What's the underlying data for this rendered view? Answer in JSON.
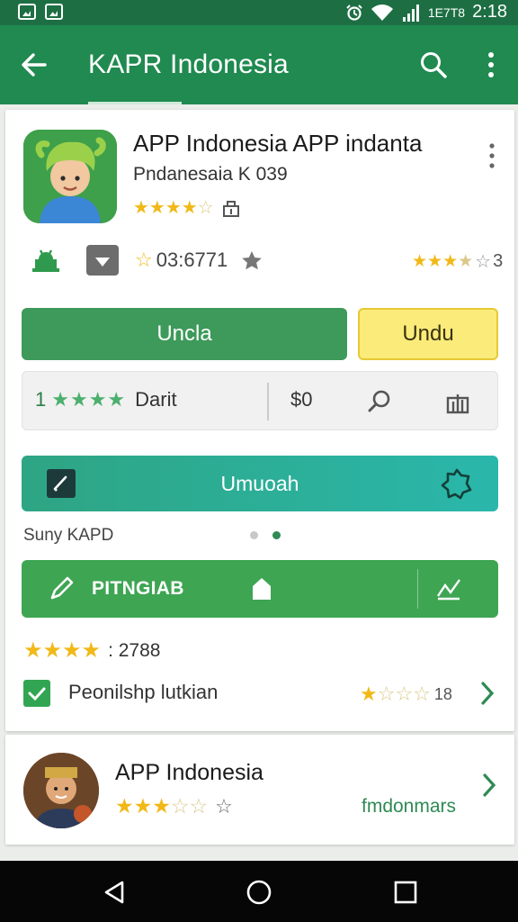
{
  "status_bar": {
    "carrier": "1E7T8",
    "time": "2:18"
  },
  "app_bar": {
    "title": "KAPR Indonesia"
  },
  "app": {
    "title": "APP Indonesia APP indanta",
    "subtitle": "Pndanesaia K 039",
    "rating_stars": 4.5
  },
  "stats": {
    "downloads": "03:6771",
    "right_rating_suffix": "3"
  },
  "buttons": {
    "primary": "Uncla",
    "secondary": "Undu"
  },
  "info": {
    "rating_number": "1",
    "rating_label": "Darit",
    "price": "$0"
  },
  "teal_bar": {
    "label": "Umuoah"
  },
  "support": {
    "label": "Suny KAPD"
  },
  "green_bar": {
    "label": "PITNGIAB"
  },
  "rating_line": {
    "value": ": 2788"
  },
  "permission": {
    "label": "Peonilshp lutkian",
    "rating_suffix": "18"
  },
  "card2": {
    "title": "APP Indonesia",
    "link": "fmdonmars"
  },
  "colors": {
    "status_bar": "#1d6f43",
    "app_bar": "#208a50",
    "primary_button": "#3d9a5a",
    "secondary_button": "#fbeb7a",
    "teal_bar_start": "#2ea583",
    "teal_bar_end": "#2ab7ab",
    "green_bar": "#3ea553",
    "star": "#f1b918"
  },
  "icons": {
    "status_left": [
      "image-icon",
      "photo-icon"
    ],
    "status_right": [
      "alarm-icon",
      "wifi-icon",
      "signal-icon"
    ],
    "app_bar": [
      "back-arrow-icon",
      "search-icon",
      "more-vert-icon"
    ],
    "row": [
      "android-icon",
      "download-box-icon",
      "star-outline-icon"
    ],
    "info_box": [
      "search-icon",
      "share-icon"
    ],
    "nav": [
      "back-triangle-icon",
      "home-circle-icon",
      "recents-square-icon"
    ]
  }
}
